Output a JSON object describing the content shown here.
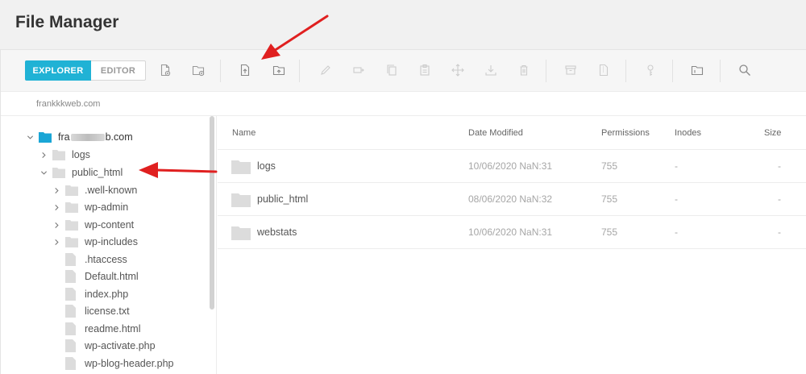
{
  "page": {
    "title": "File Manager"
  },
  "toolbar": {
    "explorer_label": "EXPLORER",
    "editor_label": "EDITOR",
    "icons": [
      "new-file-icon",
      "new-folder-icon",
      "upload-file-icon",
      "upload-folder-icon",
      "rename-icon",
      "move-icon",
      "copy-icon",
      "paste-icon",
      "drag-icon",
      "download-icon",
      "delete-icon",
      "archive-icon",
      "extract-icon",
      "permissions-icon",
      "info-icon",
      "search-icon"
    ]
  },
  "breadcrumb": {
    "path": "frankkkweb.com"
  },
  "tree": {
    "root": {
      "prefix": "fra",
      "suffix": "b.com"
    },
    "items": [
      {
        "label": "logs"
      },
      {
        "label": "public_html"
      },
      {
        "label": ".well-known"
      },
      {
        "label": "wp-admin"
      },
      {
        "label": "wp-content"
      },
      {
        "label": "wp-includes"
      },
      {
        "label": ".htaccess"
      },
      {
        "label": "Default.html"
      },
      {
        "label": "index.php"
      },
      {
        "label": "license.txt"
      },
      {
        "label": "readme.html"
      },
      {
        "label": "wp-activate.php"
      },
      {
        "label": "wp-blog-header.php"
      }
    ]
  },
  "table": {
    "headers": {
      "name": "Name",
      "date": "Date Modified",
      "perm": "Permissions",
      "inodes": "Inodes",
      "size": "Size"
    },
    "rows": [
      {
        "name": "logs",
        "date": "10/06/2020 NaN:31",
        "perm": "755",
        "inodes": "-",
        "size": "-"
      },
      {
        "name": "public_html",
        "date": "08/06/2020 NaN:32",
        "perm": "755",
        "inodes": "-",
        "size": "-"
      },
      {
        "name": "webstats",
        "date": "10/06/2020 NaN:31",
        "perm": "755",
        "inodes": "-",
        "size": "-"
      }
    ]
  },
  "colors": {
    "accent": "#20b2d5",
    "folder_root": "#1aa6d6",
    "folder": "#dcdcdc",
    "annotation_arrow": "#e02020"
  }
}
